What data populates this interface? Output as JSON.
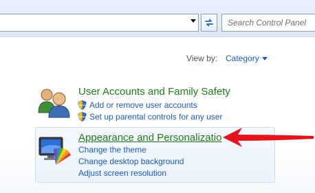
{
  "toolbar": {
    "search_placeholder": "Search Control Panel"
  },
  "view": {
    "label": "View by:",
    "value": "Category"
  },
  "categories": [
    {
      "title": "User Accounts and Family Safety",
      "links": [
        "Add or remove user accounts",
        "Set up parental controls for any user"
      ]
    },
    {
      "title": "Appearance and Personalizatio",
      "links": [
        "Change the theme",
        "Change desktop background",
        "Adjust screen resolution"
      ]
    }
  ],
  "colors": {
    "category_title": "#227a1b",
    "link": "#1e5bbd",
    "annotation_arrow": "#e2141c"
  }
}
